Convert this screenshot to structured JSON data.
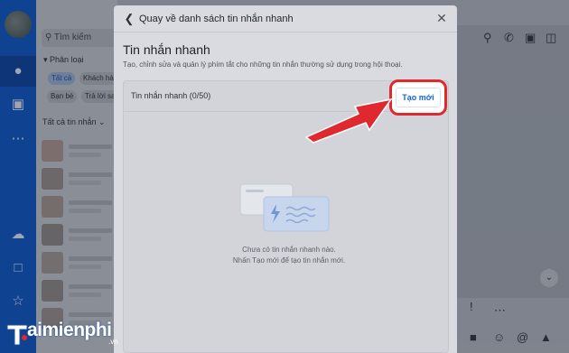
{
  "background_app": {
    "search_placeholder": "Tìm kiếm",
    "filter_label": "Phân loại",
    "chips": [
      "Tất cả",
      "Khách hà",
      "Bạn bè",
      "Trả lời sa"
    ],
    "all_messages_label": "Tất cả tin nhắn"
  },
  "modal": {
    "title": "Quay về danh sách tin nhắn nhanh",
    "section_title": "Tin nhắn nhanh",
    "section_desc": "Tạo, chỉnh sửa và quản lý phím tắt cho những tin nhắn thường sử dụng trong hội thoại.",
    "list_label": "Tin nhắn nhanh (0/50)",
    "create_button": "Tạo mới",
    "empty_line1": "Chưa có tin nhắn nhanh nào.",
    "empty_line2": "Nhấn Tạo mới để tạo tin nhắn mới."
  },
  "logo": {
    "text": "aimienphi",
    "suffix": ".vn"
  },
  "colors": {
    "sidebar": "#0a56c9",
    "accent": "#1463d9",
    "highlight": "#e0282f"
  }
}
